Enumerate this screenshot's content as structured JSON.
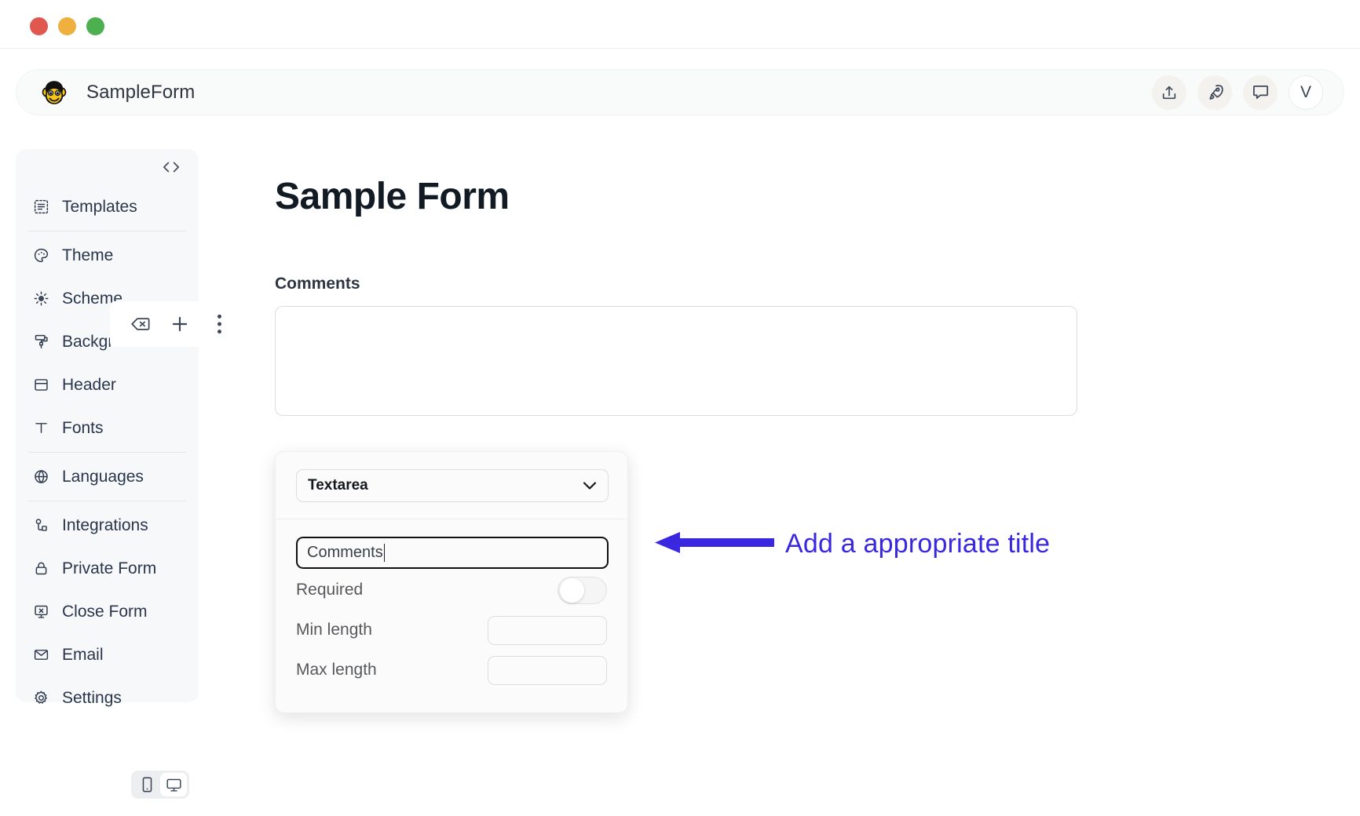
{
  "window": {
    "traffic_lights": [
      {
        "name": "close",
        "color": "#e0574f"
      },
      {
        "name": "minimize",
        "color": "#f0b040"
      },
      {
        "name": "maximize",
        "color": "#4cb050"
      }
    ]
  },
  "header": {
    "logo_icon": "monkey-face-icon",
    "logo_glyph": "🐵",
    "title": "SampleForm",
    "actions": [
      {
        "name": "share-upload-icon",
        "label": "Share"
      },
      {
        "name": "rocket-publish-icon",
        "label": "Publish"
      },
      {
        "name": "chat-comment-icon",
        "label": "Comments"
      }
    ],
    "avatar_initial": "V"
  },
  "sidebar": {
    "code_toggle_icon": "code-brackets-icon",
    "items": [
      {
        "label": "Templates",
        "icon": "templates-icon"
      },
      {
        "label": "Theme",
        "icon": "palette-icon"
      },
      {
        "label": "Scheme",
        "icon": "sun-contrast-icon"
      },
      {
        "label": "Background",
        "icon": "paint-roller-icon"
      },
      {
        "label": "Header",
        "icon": "header-layout-icon"
      },
      {
        "label": "Fonts",
        "icon": "font-t-icon"
      },
      {
        "label": "Languages",
        "icon": "globe-icon"
      },
      {
        "label": "Integrations",
        "icon": "integrations-nodes-icon"
      },
      {
        "label": "Private Form",
        "icon": "lock-icon"
      },
      {
        "label": "Close Form",
        "icon": "close-screen-icon"
      },
      {
        "label": "Email",
        "icon": "envelope-icon"
      },
      {
        "label": "Settings",
        "icon": "gear-icon"
      }
    ]
  },
  "device_toggle": {
    "options": [
      {
        "name": "mobile",
        "icon": "mobile-icon",
        "active": false
      },
      {
        "name": "desktop",
        "icon": "desktop-icon",
        "active": true
      }
    ]
  },
  "element_toolbar": {
    "buttons": [
      {
        "name": "delete-field-button",
        "icon": "backspace-delete-icon"
      },
      {
        "name": "add-field-button",
        "icon": "plus-icon"
      },
      {
        "name": "more-options-button",
        "icon": "vertical-dots-icon"
      }
    ]
  },
  "form": {
    "title": "Sample Form",
    "fields": [
      {
        "label": "Comments",
        "type": "textarea",
        "value": ""
      }
    ]
  },
  "field_settings": {
    "type_value": "Textarea",
    "type_caret_icon": "chevron-down-icon",
    "title_value": "Comments",
    "rows": [
      {
        "label": "Required",
        "control": "toggle",
        "value": "off"
      },
      {
        "label": "Min length",
        "control": "input",
        "value": ""
      },
      {
        "label": "Max length",
        "control": "input",
        "value": ""
      }
    ]
  },
  "annotation": {
    "text": "Add a appropriate title",
    "color": "#3a27e0",
    "arrow_direction": "left"
  }
}
